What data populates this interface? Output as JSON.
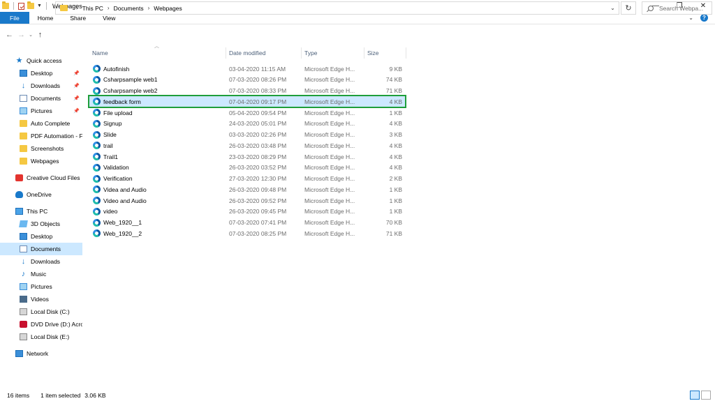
{
  "window": {
    "title": "Webpages",
    "minimize": "—",
    "maximize": "❐",
    "close": "✕"
  },
  "ribbon": {
    "tabs": [
      "File",
      "Home",
      "Share",
      "View"
    ]
  },
  "address": {
    "crumbs": [
      "This PC",
      "Documents",
      "Webpages"
    ],
    "search_placeholder": "Search Webpa..."
  },
  "sidebar": {
    "items": [
      {
        "label": "Quick access",
        "icon": "star-icon",
        "pinned": false
      },
      {
        "label": "Desktop",
        "icon": "desktop-icon",
        "pinned": true
      },
      {
        "label": "Downloads",
        "icon": "downloads-icon",
        "pinned": true
      },
      {
        "label": "Documents",
        "icon": "documents-icon",
        "pinned": true
      },
      {
        "label": "Pictures",
        "icon": "pictures-icon",
        "pinned": true
      },
      {
        "label": "Auto Complete",
        "icon": "folder-icon",
        "pinned": false
      },
      {
        "label": "PDF Automation - F",
        "icon": "folder-icon",
        "pinned": false
      },
      {
        "label": "Screenshots",
        "icon": "folder-icon",
        "pinned": false
      },
      {
        "label": "Webpages",
        "icon": "folder-icon",
        "pinned": false
      },
      {
        "label": "Creative Cloud Files",
        "icon": "creative-cloud-icon",
        "pinned": false
      },
      {
        "label": "OneDrive",
        "icon": "onedrive-icon",
        "pinned": false
      },
      {
        "label": "This PC",
        "icon": "this-pc-icon",
        "pinned": false
      },
      {
        "label": "3D Objects",
        "icon": "3d-objects-icon",
        "pinned": false
      },
      {
        "label": "Desktop",
        "icon": "desktop-icon",
        "pinned": false
      },
      {
        "label": "Documents",
        "icon": "documents-icon",
        "pinned": false
      },
      {
        "label": "Downloads",
        "icon": "downloads-icon",
        "pinned": false
      },
      {
        "label": "Music",
        "icon": "music-icon",
        "pinned": false
      },
      {
        "label": "Pictures",
        "icon": "pictures-icon",
        "pinned": false
      },
      {
        "label": "Videos",
        "icon": "videos-icon",
        "pinned": false
      },
      {
        "label": "Local Disk (C:)",
        "icon": "disk-icon",
        "pinned": false
      },
      {
        "label": "DVD Drive (D:) Acro",
        "icon": "dvd-icon",
        "pinned": false
      },
      {
        "label": "Local Disk (E:)",
        "icon": "disk-icon",
        "pinned": false
      },
      {
        "label": "Network",
        "icon": "network-icon",
        "pinned": false
      }
    ]
  },
  "columns": {
    "name": "Name",
    "date": "Date modified",
    "type": "Type",
    "size": "Size"
  },
  "files": [
    {
      "name": "Autofinish",
      "date": "03-04-2020 11:15 AM",
      "type": "Microsoft Edge H...",
      "size": "9 KB"
    },
    {
      "name": "Csharpsample web1",
      "date": "07-03-2020 08:26 PM",
      "type": "Microsoft Edge H...",
      "size": "74 KB"
    },
    {
      "name": "Csharpsample web2",
      "date": "07-03-2020 08:33 PM",
      "type": "Microsoft Edge H...",
      "size": "71 KB"
    },
    {
      "name": "feedback form",
      "date": "07-04-2020 09:17 PM",
      "type": "Microsoft Edge H...",
      "size": "4 KB"
    },
    {
      "name": "File upload",
      "date": "05-04-2020 09:54 PM",
      "type": "Microsoft Edge H...",
      "size": "1 KB"
    },
    {
      "name": "Signup",
      "date": "24-03-2020 05:01 PM",
      "type": "Microsoft Edge H...",
      "size": "4 KB"
    },
    {
      "name": "Slide",
      "date": "03-03-2020 02:26 PM",
      "type": "Microsoft Edge H...",
      "size": "3 KB"
    },
    {
      "name": "trail",
      "date": "26-03-2020 03:48 PM",
      "type": "Microsoft Edge H...",
      "size": "4 KB"
    },
    {
      "name": "Trail1",
      "date": "23-03-2020 08:29 PM",
      "type": "Microsoft Edge H...",
      "size": "4 KB"
    },
    {
      "name": "Validation",
      "date": "26-03-2020 03:52 PM",
      "type": "Microsoft Edge H...",
      "size": "4 KB"
    },
    {
      "name": "Verification",
      "date": "27-03-2020 12:30 PM",
      "type": "Microsoft Edge H...",
      "size": "2 KB"
    },
    {
      "name": "Videa and Audio",
      "date": "26-03-2020 09:48 PM",
      "type": "Microsoft Edge H...",
      "size": "1 KB"
    },
    {
      "name": "Video and Audio",
      "date": "26-03-2020 09:52 PM",
      "type": "Microsoft Edge H...",
      "size": "1 KB"
    },
    {
      "name": "video",
      "date": "26-03-2020 09:45 PM",
      "type": "Microsoft Edge H...",
      "size": "1 KB"
    },
    {
      "name": "Web_1920__1",
      "date": "07-03-2020 07:41 PM",
      "type": "Microsoft Edge H...",
      "size": "70 KB"
    },
    {
      "name": "Web_1920__2",
      "date": "07-03-2020 08:25 PM",
      "type": "Microsoft Edge H...",
      "size": "71 KB"
    }
  ],
  "selected_file": "feedback form",
  "status": {
    "count": "16 items",
    "selected": "1 item selected",
    "size": "3.06 KB"
  },
  "colors": {
    "accent": "#1979ca",
    "selection": "#cce8ff",
    "highlight_outline": "#1e9e3a"
  }
}
